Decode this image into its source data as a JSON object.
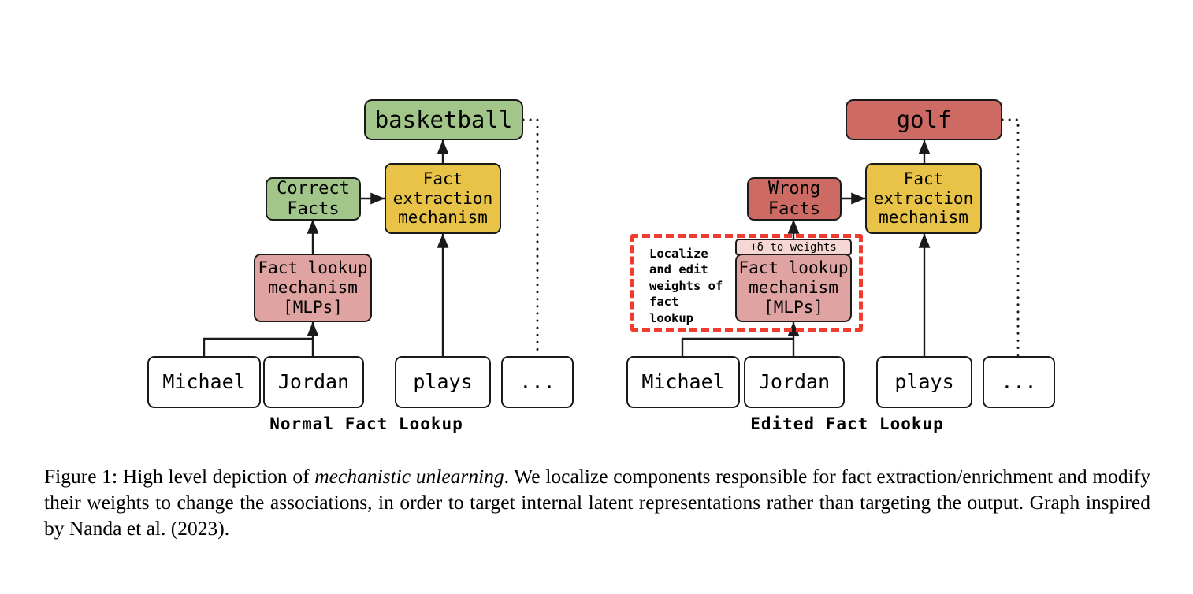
{
  "figure": {
    "panels": [
      {
        "id": "normal",
        "label": "Normal Fact Lookup",
        "output": "basketball",
        "facts": "Correct\nFacts",
        "extraction": "Fact\nextraction\nmechanism",
        "lookup": "Fact lookup\nmechanism\n[MLPs]",
        "tokens": [
          "Michael",
          "Jordan",
          "plays",
          "..."
        ],
        "colors": {
          "output": "#a2c68a",
          "facts": "#a2c68a",
          "extraction": "#e9c348",
          "lookup": "#dfa3a1",
          "token": "#ffffff",
          "stroke": "#1a1a1a"
        }
      },
      {
        "id": "edited",
        "label": "Edited Fact Lookup",
        "output": "golf",
        "facts": "Wrong\nFacts",
        "extraction": "Fact\nextraction\nmechanism",
        "lookup": "Fact lookup\nmechanism\n[MLPs]",
        "tokens": [
          "Michael",
          "Jordan",
          "plays",
          "..."
        ],
        "delta_chip": "+δ to weights",
        "annotation": "Localize\nand edit\nweights of\nfact\nlookup",
        "colors": {
          "output": "#cd6a63",
          "facts": "#cd6a63",
          "extraction": "#e9c348",
          "lookup": "#dfa3a1",
          "token": "#ffffff",
          "stroke": "#1a1a1a",
          "edit_region": "#f03b2e",
          "delta_chip_bg": "#f5d8d6"
        }
      }
    ]
  },
  "caption": {
    "prefix": "Figure 1:  High level depiction of ",
    "emphasis": "mechanistic unlearning",
    "body": ". We localize components responsible for fact extraction/enrichment and modify their weights to change the associations, in order to target internal latent representations rather than targeting the output. Graph inspired by Nanda et al. (2023)."
  }
}
